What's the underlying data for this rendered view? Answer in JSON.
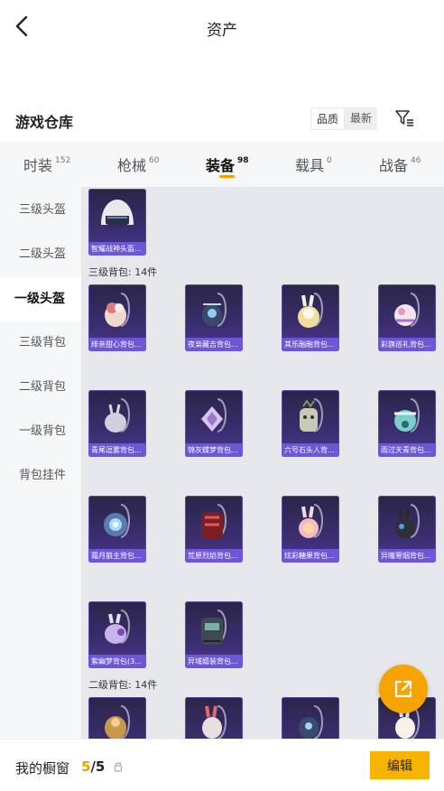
{
  "header": {
    "title": "资产",
    "back_icon": "chevron-left-icon"
  },
  "warehouse": {
    "title": "游戏仓库",
    "sort_quality": "品质",
    "sort_newest": "最新",
    "filter_icon": "filter-icon"
  },
  "tabs": [
    {
      "label": "时装",
      "count": "152"
    },
    {
      "label": "枪械",
      "count": "60"
    },
    {
      "label": "装备",
      "count": "98",
      "active": true
    },
    {
      "label": "载具",
      "count": "0"
    },
    {
      "label": "战备",
      "count": "46"
    }
  ],
  "sidebar": [
    {
      "label": "三级头盔"
    },
    {
      "label": "二级头盔"
    },
    {
      "label": "一级头盔",
      "active": true
    },
    {
      "label": "三级背包"
    },
    {
      "label": "二级背包"
    },
    {
      "label": "一级背包"
    },
    {
      "label": "背包挂件"
    }
  ],
  "content": {
    "top_item": {
      "name": "智耀战神头盔..."
    },
    "section1": {
      "label": "三级背包: 14件",
      "items": [
        {
          "name": "绯亲甜心背包..."
        },
        {
          "name": "夜枭藏吉背包..."
        },
        {
          "name": "其乐融融背包..."
        },
        {
          "name": "彩旗巡礼背包..."
        },
        {
          "name": "青尾逗雾背包..."
        },
        {
          "name": "锦灰蝶梦背包..."
        },
        {
          "name": "六号石头人背..."
        },
        {
          "name": "雨过天青背包..."
        },
        {
          "name": "霜月狼主背包..."
        },
        {
          "name": "荒原烈焰背包..."
        },
        {
          "name": "炫彩糖果背包..."
        },
        {
          "name": "异瞳寒烟背包..."
        },
        {
          "name": "紫幽梦背包(3..."
        },
        {
          "name": "异域嬉装背包..."
        }
      ]
    },
    "section2": {
      "label": "二级背包: 14件"
    }
  },
  "fab": {
    "icon": "share-export-icon"
  },
  "bottom": {
    "label": "我的橱窗",
    "count_current": "5",
    "count_sep_total": "/5",
    "lock_icon": "lock-icon",
    "edit_label": "编辑"
  },
  "colors": {
    "accent": "#f6a400",
    "card_bg": "#3b2d6f",
    "card_label": "#6d57d6",
    "content_bg": "#e7e8ec",
    "sidebar_bg": "#f5f7f9"
  }
}
